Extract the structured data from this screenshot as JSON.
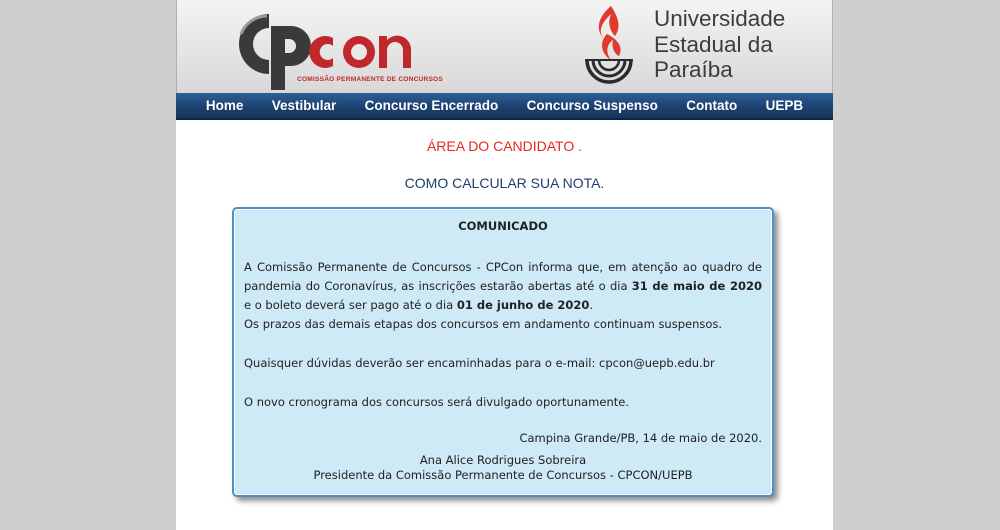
{
  "header": {
    "logo_text": "CPCON",
    "logo_subtitle": "COMISSÃO PERMANENTE DE CONCURSOS",
    "university_line1": "Universidade",
    "university_line2": "Estadual da",
    "university_line3": "Paraíba",
    "colors": {
      "logo_gray": "#3a3a3a",
      "logo_red": "#c0282c",
      "emblem_red": "#e03a2f"
    }
  },
  "nav": {
    "items": [
      {
        "label": "Home"
      },
      {
        "label": "Vestibular"
      },
      {
        "label": "Concurso Encerrado"
      },
      {
        "label": "Concurso Suspenso"
      },
      {
        "label": "Contato"
      },
      {
        "label": "UEPB"
      }
    ]
  },
  "main": {
    "area_link": "ÁREA DO CANDIDATO .",
    "calc_link": "COMO CALCULAR SUA NOTA."
  },
  "notice": {
    "heading": "COMUNICADO",
    "para1_a": "A Comissão Permanente de Concursos - CPCon informa que, em atenção ao quadro de pandemia do Coronavírus, as inscrições estarão abertas até o dia ",
    "para1_date1": "31 de maio de 2020",
    "para1_b": " e o boleto deverá ser pago até o dia ",
    "para1_date2": "01 de junho de 2020",
    "para1_c": ".",
    "para2": "Os prazos das demais etapas dos concursos em andamento continuam suspensos.",
    "para3_a": "Quaisquer dúvidas deverão ser encaminhadas para o e-mail: ",
    "para3_email": "cpcon@uepb.edu.br",
    "para4": "O novo cronograma dos concursos será divulgado oportunamente.",
    "place_date": "Campina Grande/PB, 14 de maio de 2020.",
    "signer_name": "Ana Alice Rodrigues Sobreira",
    "signer_title": "Presidente da Comissão Permanente de Concursos - CPCON/UEPB"
  }
}
